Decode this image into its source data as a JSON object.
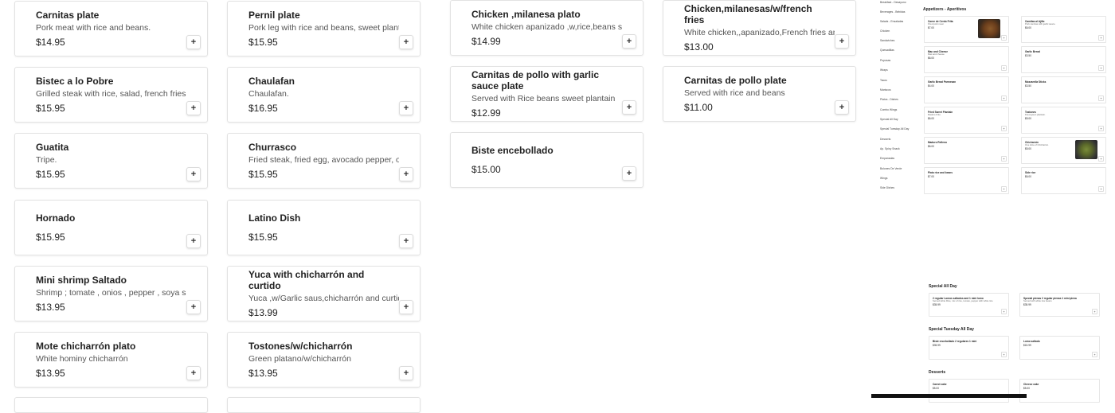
{
  "items": [
    {
      "name": "Carnitas plate",
      "desc": "Pork meat with rice and beans.",
      "price": "$14.95"
    },
    {
      "name": "Pernil plate",
      "desc": "Pork leg with rice and beans, sweet plantain and avocado.",
      "price": "$15.95"
    },
    {
      "name": "Bistec a lo Pobre",
      "desc": "Grilled steak with rice, salad, french fries and egg.",
      "price": "$15.95"
    },
    {
      "name": "Chaulafan",
      "desc": "Chaulafan.",
      "price": "$16.95"
    },
    {
      "name": "Guatita",
      "desc": "Tripe.",
      "price": "$15.95"
    },
    {
      "name": "Churrasco",
      "desc": "Fried steak, fried egg, avocado pepper, onions, french fries.",
      "price": "$15.95"
    },
    {
      "name": "Hornado",
      "desc": "",
      "price": "$15.95"
    },
    {
      "name": "Latino Dish",
      "desc": "",
      "price": "$15.95"
    },
    {
      "name": "Mini shrimp Saltado",
      "desc": "Shrimp ; tomate , onios , pepper , soya sause mix)",
      "price": "$13.95"
    },
    {
      "name": "Yuca with chicharrón and curtido",
      "desc": "Yuca ,w/Garlic saus,chicharrón and curtido",
      "price": "$13.99"
    },
    {
      "name": "Mote chicharrón plato",
      "desc": "White hominy chicharrón",
      "price": "$13.95"
    },
    {
      "name": "Tostones/w/chicharrón",
      "desc": "Green platano/w/chicharrón",
      "price": "$13.95"
    },
    {
      "name": "Chicken ,milanesa plato",
      "desc": "White chicken apanizado ,w,rice,beans sweet platano,avocado,salad",
      "price": "$14.99"
    },
    {
      "name": "Chicken,milanesas/w/french fries",
      "desc": "White chicken,,apanizado,French fries and salad",
      "price": "$13.00"
    },
    {
      "name": "Carnitas de pollo with garlic sauce plate",
      "desc": "Served with Rice beans sweet plantain",
      "price": "$12.99"
    },
    {
      "name": "Carnitas de pollo plate",
      "desc": "Served with rice and beans",
      "price": "$11.00"
    },
    {
      "name": "Biste encebollado",
      "desc": "",
      "price": "$15.00"
    }
  ],
  "add_icon": "plus-icon",
  "mini": {
    "categories": [
      "Breakfast - Desayuno",
      "Beverages - Bebidas",
      "Salads - Ensaladas",
      "Chicken",
      "Sandwiches",
      "Quesadillas",
      "Pupusas",
      "Wraps",
      "Tacos",
      "Mariscos",
      "Platos - Dishes",
      "Combo Wings",
      "Special All Day",
      "Special Tuesday All Day",
      "Desserts",
      "Ap. Spicy Snack",
      "Empanadas",
      "Bolones De Verde",
      "Wings",
      "Side Dishes"
    ],
    "sections": {
      "appetizers": "Appetizers - Aperitivos",
      "special_all_day": "Special All Day",
      "special_tuesday": "Special Tuesday All Day",
      "desserts": "Desserts"
    },
    "appetizers": [
      {
        "name": "Carne de Cerdo Frita",
        "desc": "Fried pork meat",
        "price": "$7.00"
      },
      {
        "name": "Camitas al Ajillo",
        "desc": "Pork camitas with garlic sauce.",
        "price": "$6.00"
      },
      {
        "name": "Mac and Cheese",
        "desc": "Mac and cheese.",
        "price": "$6.00"
      },
      {
        "name": "Garlic Bread",
        "desc": "",
        "price": "$3.50"
      },
      {
        "name": "Garlic Bread Parmesan",
        "desc": "",
        "price": "$4.00"
      },
      {
        "name": "Mozzarella Sticks",
        "desc": "",
        "price": "$3.50"
      },
      {
        "name": "Fried Sweet Plantain",
        "desc": "Maduro Frito.",
        "price": "$6.00"
      },
      {
        "name": "Tostones",
        "desc": "Fried green plantain.",
        "price": "$5.00"
      },
      {
        "name": "Maduro Relleno",
        "desc": "",
        "price": "$6.00"
      },
      {
        "name": "Chicharrón",
        "desc": "One slice of Chicharrón.",
        "price": "$5.00"
      },
      {
        "name": "Plato rice and beans",
        "desc": "",
        "price": "$7.00"
      },
      {
        "name": "Side rice",
        "desc": "",
        "price": "$6.00"
      }
    ],
    "special_all_day": [
      {
        "name": "2 regular Lomos saltados and 1 mini lomo",
        "desc": "Served white Rice, mix of rice, tomato, pepper with white rice",
        "price": "$35.99"
      },
      {
        "name": "Special pienas 2 regular pienas 1 mini piena",
        "desc": "Served with white rice beans",
        "price": "$35.99"
      }
    ],
    "special_tuesday": [
      {
        "name": "Biste encebollado 2 regulares 1 mini",
        "desc": "",
        "price": "$35.99"
      },
      {
        "name": "Lomo saltado",
        "desc": "",
        "price": "$15.99"
      }
    ],
    "desserts": [
      {
        "name": "Carrot cake",
        "desc": "",
        "price": "$5.00"
      },
      {
        "name": "Cheese cake",
        "desc": "",
        "price": "$5.00"
      }
    ]
  }
}
